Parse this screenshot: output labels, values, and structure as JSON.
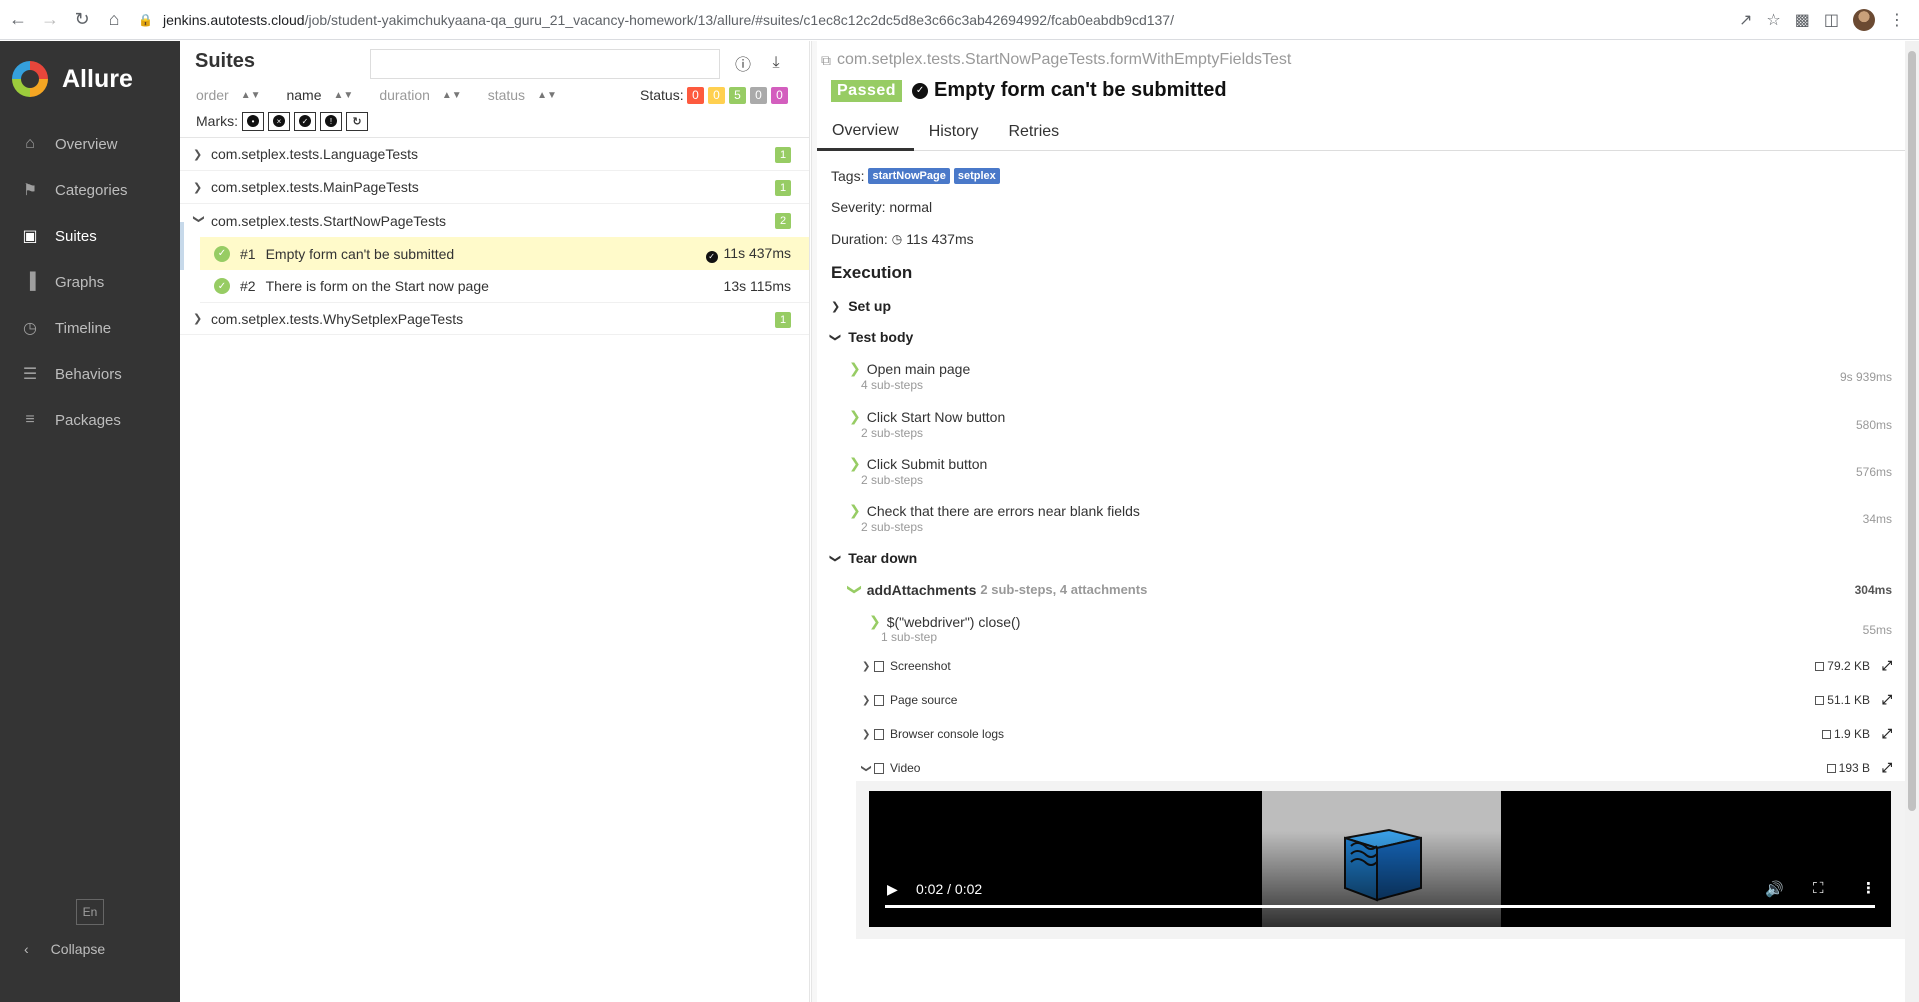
{
  "browser": {
    "url_host": "jenkins.autotests.cloud",
    "url_path": "/job/student-yakimchukyaana-qa_guru_21_vacancy-homework/13/allure/#suites/c1ec8c12c2dc5d8e3c66c3ab42694992/fcab0eabdb9cd137/",
    "icons": [
      "back-icon",
      "forward-icon",
      "reload-icon",
      "home-icon",
      "lock-icon",
      "share-icon",
      "star-icon",
      "extensions-icon",
      "side-panel-icon",
      "profile-avatar"
    ]
  },
  "sidebar": {
    "brand": "Allure",
    "items": [
      {
        "label": "Overview",
        "icon": "home-icon"
      },
      {
        "label": "Categories",
        "icon": "flag-icon"
      },
      {
        "label": "Suites",
        "icon": "briefcase-icon"
      },
      {
        "label": "Graphs",
        "icon": "bar-chart-icon"
      },
      {
        "label": "Timeline",
        "icon": "clock-icon"
      },
      {
        "label": "Behaviors",
        "icon": "list-icon"
      },
      {
        "label": "Packages",
        "icon": "align-left-icon"
      }
    ],
    "active": "Suites",
    "language": "En",
    "collapse_label": "Collapse"
  },
  "suites": {
    "title": "Suites",
    "search_placeholder": "",
    "sort": [
      "order",
      "name",
      "duration",
      "status"
    ],
    "sort_active": "name",
    "status_label": "Status:",
    "status_counts": [
      {
        "value": "0",
        "color": "#fd5a3e"
      },
      {
        "value": "0",
        "color": "#ffd050"
      },
      {
        "value": "5",
        "color": "#97cc64"
      },
      {
        "value": "0",
        "color": "#aaaaaa"
      },
      {
        "value": "0",
        "color": "#d35ebe"
      }
    ],
    "marks_label": "Marks:",
    "groups": [
      {
        "name": "com.setplex.tests.LanguageTests",
        "count": "1",
        "expanded": false
      },
      {
        "name": "com.setplex.tests.MainPageTests",
        "count": "1",
        "expanded": false
      },
      {
        "name": "com.setplex.tests.StartNowPageTests",
        "count": "2",
        "expanded": true
      },
      {
        "name": "com.setplex.tests.WhySetplexPageTests",
        "count": "1",
        "expanded": false
      }
    ],
    "tests": [
      {
        "num": "#1",
        "name": "Empty form can't be submitted",
        "duration": "11s 437ms",
        "selected": true
      },
      {
        "num": "#2",
        "name": "There is form on the Start now page",
        "duration": "13s 115ms",
        "selected": false
      }
    ]
  },
  "detail": {
    "full_name": "com.setplex.tests.StartNowPageTests.formWithEmptyFieldsTest",
    "status": "Passed",
    "title": "Empty form can't be submitted",
    "tabs": [
      "Overview",
      "History",
      "Retries"
    ],
    "active_tab": "Overview",
    "tags_label": "Tags:",
    "tags": [
      "startNowPage",
      "setplex"
    ],
    "severity_label": "Severity:",
    "severity": "normal",
    "duration_label": "Duration:",
    "duration": "11s 437ms",
    "execution_title": "Execution",
    "setup_label": "Set up",
    "body_label": "Test body",
    "steps": [
      {
        "name": "Open main page",
        "sub": "4 sub-steps",
        "time": "9s 939ms"
      },
      {
        "name": "Click Start Now button",
        "sub": "2 sub-steps",
        "time": "580ms"
      },
      {
        "name": "Click Submit button",
        "sub": "2 sub-steps",
        "time": "576ms"
      },
      {
        "name": "Check that there are errors near blank fields",
        "sub": "2 sub-steps",
        "time": "34ms"
      }
    ],
    "teardown_label": "Tear down",
    "teardown": {
      "name": "addAttachments",
      "extra": "2 sub-steps, 4 attachments",
      "time": "304ms",
      "child_step": {
        "name": "$(\"webdriver\") close()",
        "sub": "1 sub-step",
        "time": "55ms"
      },
      "attachments": [
        {
          "name": "Screenshot",
          "size": "79.2 KB"
        },
        {
          "name": "Page source",
          "size": "51.1 KB"
        },
        {
          "name": "Browser console logs",
          "size": "1.9 KB"
        },
        {
          "name": "Video",
          "size": "193 B"
        }
      ]
    },
    "video": {
      "time": "0:02 / 0:02",
      "progress": 1.0
    }
  }
}
